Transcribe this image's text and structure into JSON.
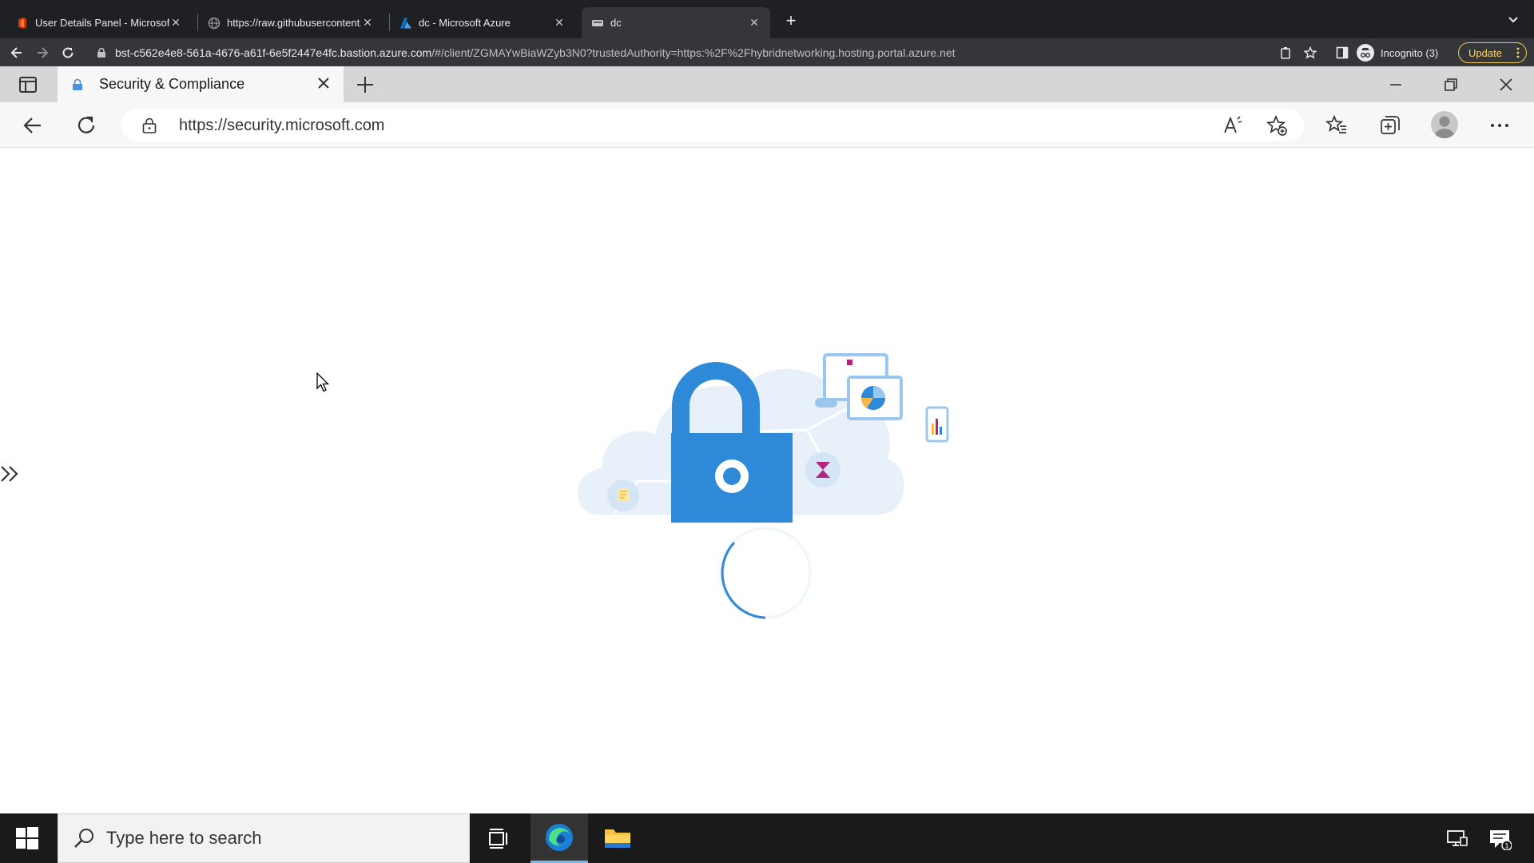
{
  "chrome": {
    "tabs": [
      {
        "title": "User Details Panel - Microsoft",
        "icon": "office-icon"
      },
      {
        "title": "https://raw.githubusercontent.",
        "icon": "globe-icon"
      },
      {
        "title": "dc - Microsoft Azure",
        "icon": "azure-icon"
      },
      {
        "title": "dc",
        "icon": "bastion-icon",
        "active": true
      }
    ],
    "address": {
      "host": "bst-c562e4e8-561a-4676-a61f-6e5f2447e4fc.bastion.azure.com",
      "path": "/#/client/ZGMAYwBiaWZyb3N0?trustedAuthority=https:%2F%2Fhybridnetworking.hosting.portal.azure.net"
    },
    "incognito_label": "Incognito (3)",
    "update_label": "Update",
    "colors": {
      "tabbar": "#1f2023",
      "toolbar": "#35363a",
      "update": "#fdd663"
    }
  },
  "edge": {
    "tab_title": "Security & Compliance",
    "url": "https://security.microsoft.com",
    "colors": {
      "accent": "#2e8ad8",
      "illustration_light": "#e8f1fa"
    }
  },
  "page": {
    "state": "loading",
    "illustration": "security-cloud-lock-illustration"
  },
  "taskbar": {
    "search_placeholder": "Type here to search",
    "notification_count": "1",
    "apps": [
      "task-view",
      "edge",
      "file-explorer"
    ]
  }
}
